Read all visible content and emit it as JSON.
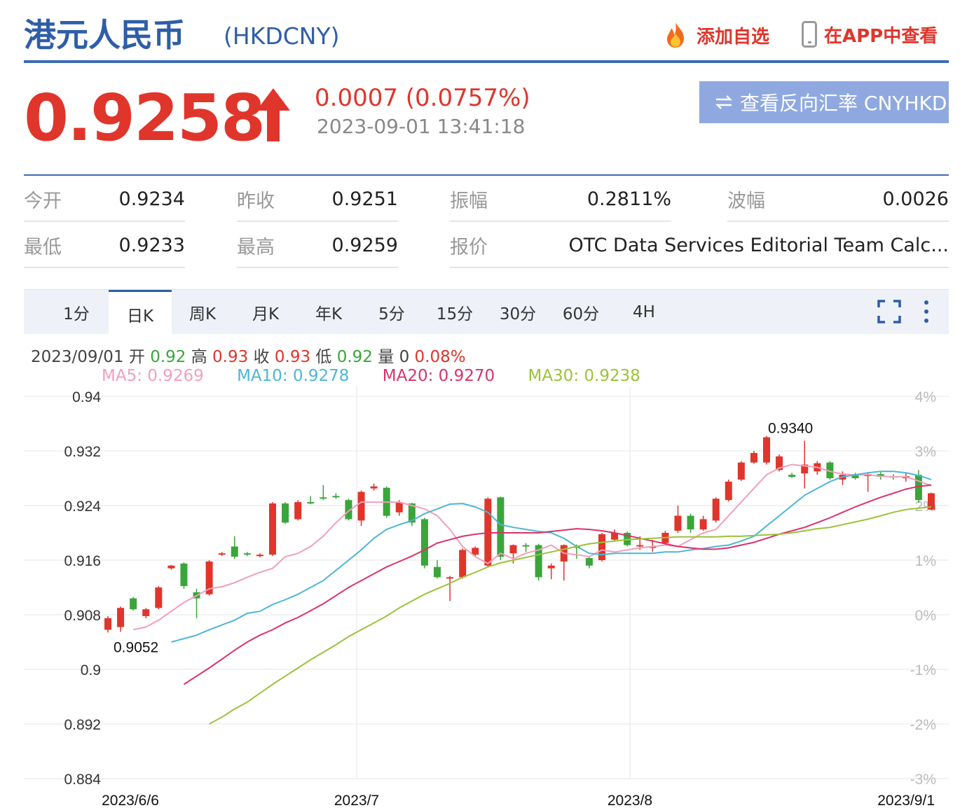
{
  "header": {
    "title": "港元人民币",
    "symbol": "(HKDCNY)",
    "add_watchlist": "添加自选",
    "view_in_app": "在APP中查看"
  },
  "quote": {
    "price": "0.9258",
    "change": "0.0007 (0.0757%)",
    "time": "2023-09-01 13:41:18",
    "reverse_button": "查看反向汇率 CNYHKD",
    "up_color": "#e0352b"
  },
  "stats": {
    "open_label": "今开",
    "open": "0.9234",
    "prev_close_label": "昨收",
    "prev_close": "0.9251",
    "amplitude_label": "振幅",
    "amplitude": "0.2811%",
    "range_label": "波幅",
    "range": "0.0026",
    "low_label": "最低",
    "low": "0.9233",
    "high_label": "最高",
    "high": "0.9259",
    "quote_label": "报价",
    "quote_source": "OTC Data Services Editorial Team Calc..."
  },
  "tabs": [
    "1分",
    "日K",
    "周K",
    "月K",
    "年K",
    "5分",
    "15分",
    "30分",
    "60分",
    "4H"
  ],
  "active_tab": "日K",
  "ohlc": {
    "date": "2023/09/01",
    "open_label": "开",
    "open": "0.92",
    "high_label": "高",
    "high": "0.93",
    "close_label": "收",
    "close": "0.93",
    "low_label": "低",
    "low": "0.92",
    "vol_label": "量",
    "vol": "0",
    "pct": "0.08%"
  },
  "ma": {
    "ma5": "MA5: 0.9269",
    "ma10": "MA10: 0.9278",
    "ma20": "MA20: 0.9270",
    "ma30": "MA30: 0.9238",
    "ma5_color": "#f0a0bc",
    "ma10_color": "#4db6d6",
    "ma20_color": "#d9336b",
    "ma30_color": "#9dc23b"
  },
  "chart_data": {
    "type": "candlestick",
    "y_ticks": [
      "0.94",
      "0.932",
      "0.924",
      "0.916",
      "0.908",
      "0.9",
      "0.892",
      "0.884"
    ],
    "y_ticks_right": [
      "4%",
      "3%",
      "2%",
      "1%",
      "0%",
      "-1%",
      "-2%",
      "-3%"
    ],
    "x_ticks": [
      "2023/6/6",
      "2023/7",
      "2023/8",
      "2023/9/1"
    ],
    "ylim": [
      0.884,
      0.94
    ],
    "annotations": [
      {
        "text": "0.9052",
        "value": 0.9052
      },
      {
        "text": "0.9340",
        "value": 0.934
      }
    ],
    "up_color": "#e0352b",
    "down_color": "#3aa53a",
    "candles": [
      [
        0.9058,
        0.9075,
        0.9054,
        0.9078
      ],
      [
        0.9062,
        0.909,
        0.9055,
        0.9092
      ],
      [
        0.9104,
        0.9088,
        0.9086,
        0.9106
      ],
      [
        0.9078,
        0.9088,
        0.9075,
        0.909
      ],
      [
        0.909,
        0.912,
        0.9088,
        0.9122
      ],
      [
        0.9148,
        0.9152,
        0.9146,
        0.9153
      ],
      [
        0.9155,
        0.9122,
        0.9118,
        0.9157
      ],
      [
        0.9113,
        0.9104,
        0.9075,
        0.9118
      ],
      [
        0.911,
        0.9158,
        0.9108,
        0.916
      ],
      [
        0.9168,
        0.917,
        0.9166,
        0.9172
      ],
      [
        0.918,
        0.9165,
        0.9162,
        0.9195
      ],
      [
        0.917,
        0.9168,
        0.9166,
        0.9172
      ],
      [
        0.9166,
        0.9168,
        0.9164,
        0.917
      ],
      [
        0.9168,
        0.9243,
        0.9166,
        0.9245
      ],
      [
        0.9243,
        0.9215,
        0.9213,
        0.9245
      ],
      [
        0.922,
        0.9245,
        0.9218,
        0.9248
      ],
      [
        0.9245,
        0.9244,
        0.9242,
        0.9254
      ],
      [
        0.9252,
        0.925,
        0.9248,
        0.927
      ],
      [
        0.9254,
        0.9252,
        0.925,
        0.9258
      ],
      [
        0.9248,
        0.922,
        0.9218,
        0.925
      ],
      [
        0.9218,
        0.926,
        0.921,
        0.9262
      ],
      [
        0.9265,
        0.9268,
        0.9262,
        0.9272
      ],
      [
        0.9266,
        0.9225,
        0.9222,
        0.9268
      ],
      [
        0.923,
        0.9245,
        0.9225,
        0.9248
      ],
      [
        0.9243,
        0.9215,
        0.921,
        0.9244
      ],
      [
        0.922,
        0.9152,
        0.9148,
        0.9222
      ],
      [
        0.915,
        0.9135,
        0.9133,
        0.916
      ],
      [
        0.9135,
        0.9135,
        0.91,
        0.9137
      ],
      [
        0.9135,
        0.9175,
        0.9133,
        0.9177
      ],
      [
        0.9168,
        0.9178,
        0.9165,
        0.918
      ],
      [
        0.9152,
        0.925,
        0.915,
        0.9252
      ],
      [
        0.9252,
        0.9165,
        0.916,
        0.9253
      ],
      [
        0.917,
        0.9182,
        0.9155,
        0.9183
      ],
      [
        0.9182,
        0.918,
        0.9172,
        0.9185
      ],
      [
        0.9182,
        0.9135,
        0.913,
        0.9184
      ],
      [
        0.9148,
        0.9152,
        0.9132,
        0.9155
      ],
      [
        0.9158,
        0.9182,
        0.913,
        0.9183
      ],
      [
        0.918,
        0.9178,
        0.9162,
        0.9183
      ],
      [
        0.9163,
        0.9152,
        0.9148,
        0.9165
      ],
      [
        0.916,
        0.9198,
        0.9158,
        0.92
      ],
      [
        0.919,
        0.92,
        0.9188,
        0.9205
      ],
      [
        0.92,
        0.9182,
        0.918,
        0.9202
      ],
      [
        0.918,
        0.9182,
        0.9175,
        0.9195
      ],
      [
        0.918,
        0.918,
        0.9172,
        0.919
      ],
      [
        0.9185,
        0.92,
        0.9183,
        0.9203
      ],
      [
        0.9203,
        0.9225,
        0.92,
        0.924
      ],
      [
        0.9225,
        0.9205,
        0.92,
        0.9228
      ],
      [
        0.9205,
        0.922,
        0.9203,
        0.9225
      ],
      [
        0.9218,
        0.925,
        0.9215,
        0.9252
      ],
      [
        0.9248,
        0.9275,
        0.9246,
        0.9278
      ],
      [
        0.9278,
        0.9303,
        0.9276,
        0.9305
      ],
      [
        0.9303,
        0.9317,
        0.9301,
        0.932
      ],
      [
        0.9303,
        0.934,
        0.93,
        0.9342
      ],
      [
        0.9292,
        0.9312,
        0.929,
        0.9315
      ],
      [
        0.9285,
        0.9282,
        0.928,
        0.9288
      ],
      [
        0.9287,
        0.93,
        0.9265,
        0.9335
      ],
      [
        0.929,
        0.9302,
        0.9285,
        0.9305
      ],
      [
        0.9303,
        0.928,
        0.9278,
        0.9305
      ],
      [
        0.9278,
        0.9285,
        0.927,
        0.929
      ],
      [
        0.9285,
        0.928,
        0.9278,
        0.9288
      ],
      [
        0.9283,
        0.9286,
        0.926,
        0.9289
      ],
      [
        0.9286,
        0.9282,
        0.9278,
        0.9289
      ],
      [
        0.9283,
        0.9282,
        0.9278,
        0.9286
      ],
      [
        0.928,
        0.9283,
        0.9275,
        0.9288
      ],
      [
        0.9285,
        0.9248,
        0.9244,
        0.9292
      ],
      [
        0.9234,
        0.9258,
        0.9233,
        0.9259
      ]
    ],
    "ma5": [
      0.9058,
      0.9062,
      0.9072,
      0.9085,
      0.9098,
      0.9108,
      0.9118,
      0.9121,
      0.9127,
      0.9135,
      0.9142,
      0.9148,
      0.9165,
      0.917,
      0.918,
      0.9195,
      0.9215,
      0.9232,
      0.9245,
      0.9245,
      0.9245,
      0.9245,
      0.924,
      0.9235,
      0.9225,
      0.9205,
      0.918,
      0.9165,
      0.9155,
      0.917,
      0.9162,
      0.917,
      0.9175,
      0.9182,
      0.917,
      0.9168,
      0.9165,
      0.9175,
      0.9172,
      0.9175,
      0.9178,
      0.918,
      0.9182,
      0.918,
      0.919,
      0.92,
      0.9205,
      0.9225,
      0.9245,
      0.9265,
      0.9285,
      0.9295,
      0.93,
      0.9298,
      0.9296,
      0.929,
      0.9286,
      0.9285,
      0.9285,
      0.9283,
      0.9282,
      0.9282,
      0.9276,
      0.9269
    ],
    "ma10": [
      0.904,
      0.9045,
      0.905,
      0.9058,
      0.9065,
      0.9072,
      0.9082,
      0.9085,
      0.9095,
      0.9102,
      0.911,
      0.912,
      0.913,
      0.9145,
      0.916,
      0.9175,
      0.9192,
      0.9205,
      0.9212,
      0.9218,
      0.9228,
      0.9235,
      0.9242,
      0.9243,
      0.9238,
      0.923,
      0.9212,
      0.9208,
      0.9205,
      0.9202,
      0.92,
      0.9192,
      0.918,
      0.917,
      0.9168,
      0.917,
      0.917,
      0.917,
      0.917,
      0.9172,
      0.9172,
      0.9175,
      0.9177,
      0.918,
      0.9182,
      0.9188,
      0.9195,
      0.921,
      0.9225,
      0.924,
      0.9255,
      0.9265,
      0.9275,
      0.9282,
      0.9285,
      0.9288,
      0.929,
      0.929,
      0.9288,
      0.9284,
      0.9278
    ],
    "ma20": [
      0.8978,
      0.899,
      0.9002,
      0.9015,
      0.9028,
      0.904,
      0.905,
      0.9058,
      0.9068,
      0.9076,
      0.9086,
      0.9096,
      0.9108,
      0.912,
      0.913,
      0.914,
      0.915,
      0.9158,
      0.9166,
      0.9175,
      0.9185,
      0.919,
      0.9195,
      0.9198,
      0.92,
      0.92,
      0.92,
      0.92,
      0.92,
      0.9202,
      0.9204,
      0.9206,
      0.9205,
      0.9203,
      0.92,
      0.9196,
      0.9192,
      0.9188,
      0.9184,
      0.918,
      0.9178,
      0.9176,
      0.9176,
      0.9178,
      0.9182,
      0.9186,
      0.9192,
      0.9198,
      0.9203,
      0.9208,
      0.9215,
      0.9222,
      0.923,
      0.9238,
      0.9245,
      0.9252,
      0.9258,
      0.9264,
      0.9268,
      0.927
    ],
    "ma30": [
      0.892,
      0.893,
      0.8942,
      0.8952,
      0.8965,
      0.8978,
      0.899,
      0.9002,
      0.9014,
      0.9025,
      0.9036,
      0.9048,
      0.9058,
      0.9068,
      0.9078,
      0.909,
      0.91,
      0.911,
      0.9118,
      0.9126,
      0.9135,
      0.9142,
      0.915,
      0.9156,
      0.916,
      0.9164,
      0.9168,
      0.9172,
      0.9176,
      0.918,
      0.9184,
      0.9186,
      0.9188,
      0.919,
      0.9191,
      0.9192,
      0.9193,
      0.9194,
      0.9194,
      0.9194,
      0.9194,
      0.9195,
      0.9195,
      0.9196,
      0.9197,
      0.9198,
      0.92,
      0.9203,
      0.9206,
      0.9208,
      0.9212,
      0.9216,
      0.922,
      0.9225,
      0.923,
      0.9234,
      0.9236,
      0.9238
    ]
  }
}
